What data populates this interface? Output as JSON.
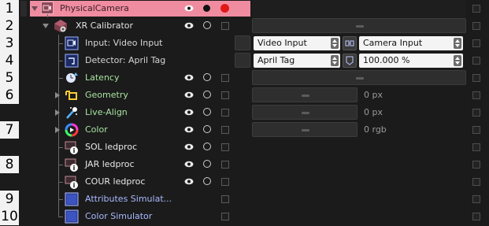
{
  "line_numbers": [
    "1",
    "2",
    "3",
    "4",
    "5",
    "6",
    "7",
    "8",
    "9",
    "10"
  ],
  "colors": {
    "background": "#1b1b1b",
    "header_bg": "#f08ca0",
    "green_label": "#a8e3a1",
    "blue_label": "#a9b8ff",
    "record_red": "#e01818"
  },
  "rows": [
    {
      "label": "PhysicalCamera",
      "icon": "camera-icon"
    },
    {
      "label": "XR Calibrator",
      "icon": "xr-calibrator-icon"
    },
    {
      "label": "Input: Video Input",
      "icon": "video-input-icon",
      "select1": "Video Input",
      "select2": "Camera Input"
    },
    {
      "label": "Detector: April Tag",
      "icon": "detector-icon",
      "select1": "April Tag",
      "value": "100.000 %"
    },
    {
      "label": "Latency",
      "icon": "latency-icon"
    },
    {
      "label": "Geometry",
      "icon": "geometry-icon",
      "value": "0",
      "unit": "px"
    },
    {
      "label": "Live-Align",
      "icon": "live-align-icon",
      "value": "0",
      "unit": "px"
    },
    {
      "label": "Color",
      "icon": "color-wheel-icon",
      "value": "0",
      "unit": "rgb"
    },
    {
      "label": "SOL ledproc",
      "icon": "ledproc-info-icon"
    },
    {
      "label": "JAR ledproc",
      "icon": "ledproc-info-icon"
    },
    {
      "label": "COUR ledproc",
      "icon": "ledproc-info-icon"
    },
    {
      "label": "Attributes Simulat...",
      "icon": "simulator-icon"
    },
    {
      "label": "Color Simulator",
      "icon": "simulator-icon"
    }
  ]
}
